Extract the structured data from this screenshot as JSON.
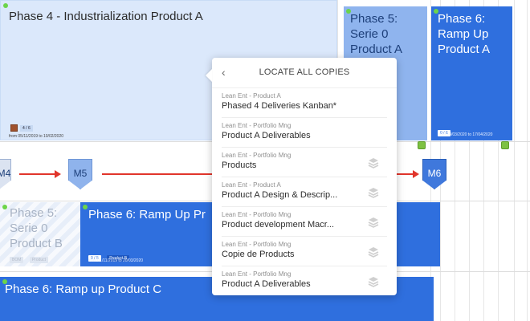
{
  "phases": {
    "phase4": {
      "title": "Phase 4 - Industrialization Product A",
      "count": "4 / 6",
      "dates": "from 05/11/2019 to 10/02/2020"
    },
    "phase5": {
      "title": "Phase 5: Serie 0 Product A"
    },
    "phase6a": {
      "title": "Phase 6: Ramp Up Product A",
      "count": "0 / 6",
      "dates": "from 18/03/2020 to 17/04/2020"
    },
    "phase5b": {
      "title": "Phase 5: Serie 0 Product B",
      "tag1": "BOM",
      "tag2": "Product"
    },
    "phase6b": {
      "title": "Phase 6: Ramp Up Pr",
      "count": "0 / 5",
      "tag": "Product B",
      "dates": "from 01/11/2019 to 20/03/2020"
    },
    "phase6c": {
      "title": "Phase 6: Ramp up Product C"
    }
  },
  "milestones": {
    "m4": "M4",
    "m5": "M5",
    "m6": "M6"
  },
  "popup": {
    "title": "LOCATE ALL COPIES",
    "back_icon": "chevron-left-icon",
    "items": [
      {
        "sub": "Lean Ent - Product A",
        "main": "Phased 4 Deliveries Kanban*",
        "icon": false
      },
      {
        "sub": "Lean Ent - Portfolio Mng",
        "main": "Product A Deliverables",
        "icon": false
      },
      {
        "sub": "Lean Ent - Portfolio Mng",
        "main": "Products",
        "icon": true
      },
      {
        "sub": "Lean Ent - Product A",
        "main": "Product A Design & Descrip...",
        "icon": true
      },
      {
        "sub": "Lean Ent - Portfolio Mng",
        "main": "Product development Macr...",
        "icon": true
      },
      {
        "sub": "Lean Ent - Portfolio Mng",
        "main": "Copie de Products",
        "icon": true
      },
      {
        "sub": "Lean Ent - Portfolio Mng",
        "main": "Product A Deliverables",
        "icon": true
      }
    ]
  },
  "colors": {
    "accent": "#2f6fde",
    "arrow": "#e1352b",
    "status_dot": "#6cd44a"
  }
}
